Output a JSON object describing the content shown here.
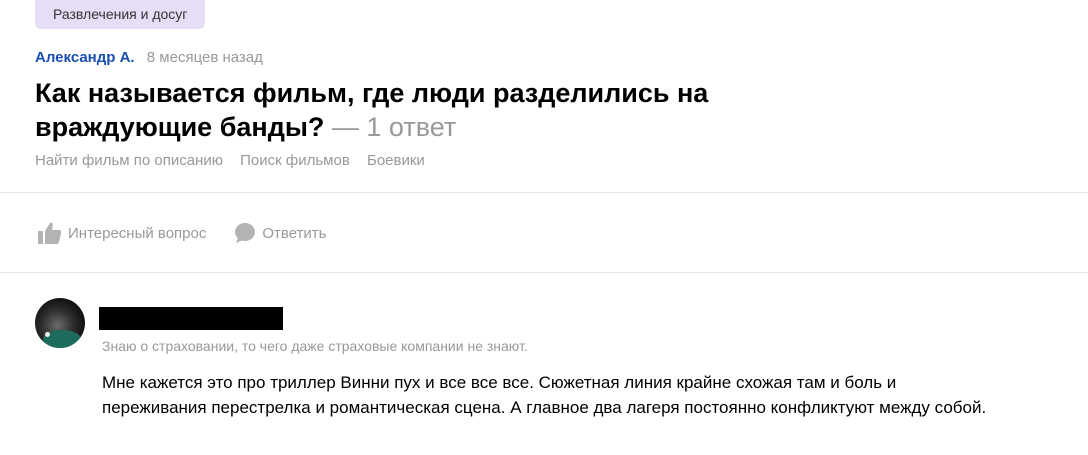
{
  "question": {
    "category": "Развлечения и досуг",
    "author": "Александр А.",
    "time_ago": "8 месяцев назад",
    "title": "Как называется фильм, где люди разделились на враждующие банды?",
    "answers_count": "— 1 ответ",
    "tags": [
      "Найти фильм по описанию",
      "Поиск фильмов",
      "Боевики"
    ]
  },
  "actions": {
    "like_label": "Интересный вопрос",
    "reply_label": "Ответить",
    "like_icon": "thumbs-up-icon",
    "reply_icon": "speech-bubble-icon"
  },
  "answer": {
    "user_bio": "Знаю о страховании, то чего даже страховые компании не знают.",
    "text": "Мне кажется это про триллер Винни пух и все все все. Сюжетная линия крайне схожая там и боль и переживания перестрелка и романтическая сцена. А главное два лагеря постоянно конфликтуют между собой."
  },
  "colors": {
    "author_link": "#1a4fb0",
    "muted_text": "#999999",
    "category_bg": "#e6def7"
  }
}
